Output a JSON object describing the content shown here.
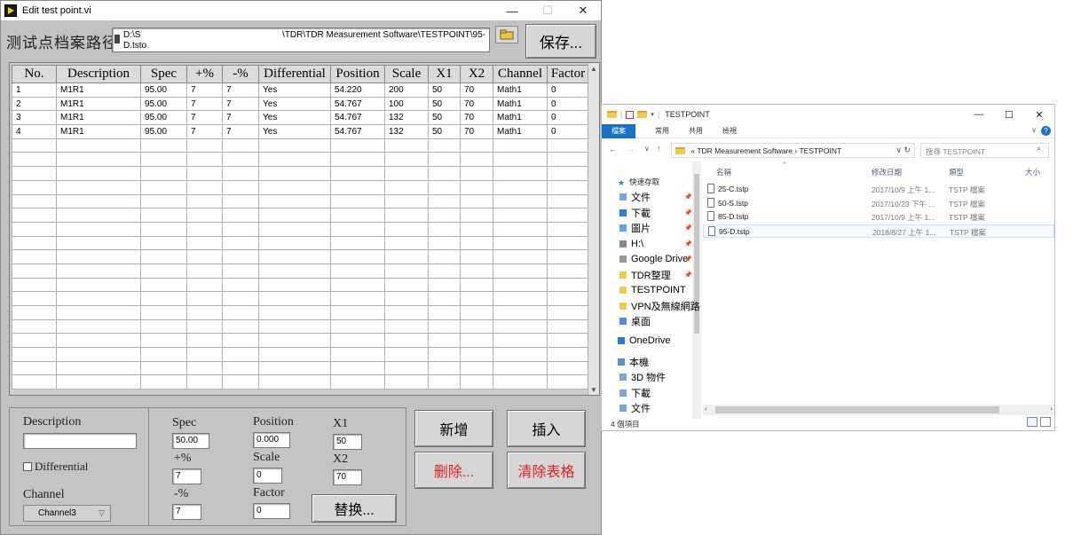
{
  "lv": {
    "title": "Edit test point.vi",
    "path_label": "测试点档案路径",
    "path_line1_left": "D:\\S",
    "path_line1_right": "\\TDR\\TDR Measurement Software\\TESTPOINT\\95-",
    "path_line2": "D.tsto",
    "save_label": "保存...",
    "columns": [
      "No.",
      "Description",
      "Spec",
      "+%",
      "-%",
      "Differential",
      "Position",
      "Scale",
      "X1",
      "X2",
      "Channel",
      "Factor"
    ],
    "rows": [
      [
        "1",
        "M1R1",
        "95.00",
        "7",
        "7",
        "Yes",
        "54.220",
        "200",
        "50",
        "70",
        "Math1",
        "0"
      ],
      [
        "2",
        "M1R1",
        "95.00",
        "7",
        "7",
        "Yes",
        "54.767",
        "100",
        "50",
        "70",
        "Math1",
        "0"
      ],
      [
        "3",
        "M1R1",
        "95.00",
        "7",
        "7",
        "Yes",
        "54.767",
        "132",
        "50",
        "70",
        "Math1",
        "0"
      ],
      [
        "4",
        "M1R1",
        "95.00",
        "7",
        "7",
        "Yes",
        "54.767",
        "132",
        "50",
        "70",
        "Math1",
        "0"
      ]
    ],
    "form": {
      "description_label": "Description",
      "description_value": "",
      "differential_label": "Differential",
      "channel_label": "Channel",
      "channel_value": "Channel3",
      "spec_label": "Spec",
      "spec_value": "50.00",
      "plus_label": "+%",
      "plus_value": "7",
      "minus_label": "-%",
      "minus_value": "7",
      "position_label": "Position",
      "position_value": "0.000",
      "scale_label": "Scale",
      "scale_value": "0",
      "factor_label": "Factor",
      "factor_value": "0",
      "x1_label": "X1",
      "x1_value": "50",
      "x2_label": "X2",
      "x2_value": "70"
    },
    "buttons": {
      "add": "新增",
      "insert": "插入",
      "delete": "删除...",
      "clear": "清除表格",
      "replace": "替换..."
    }
  },
  "explorer": {
    "title": "TESTPOINT",
    "ribbon_tabs": [
      "檔案",
      "常用",
      "共用",
      "檢視"
    ],
    "address": [
      "TDR Measurement Software",
      "TESTPOINT"
    ],
    "search_placeholder": "搜尋 TESTPOINT",
    "sidebar": {
      "quick_access": "快速存取",
      "items": [
        "文件",
        "下載",
        "圖片",
        "H:\\",
        "Google Drive",
        "TDR整理",
        "TESTPOINT",
        "VPN及無線網路",
        "桌面"
      ],
      "onedrive": "OneDrive",
      "this_pc": "本機",
      "pc_items": [
        "3D 物件",
        "下載",
        "文件"
      ]
    },
    "columns": [
      "名稱",
      "修改日期",
      "類型",
      "大小"
    ],
    "files": [
      {
        "name": "25-C.tstp",
        "date": "2017/10/9 上午 1...",
        "type": "TSTP 檔案"
      },
      {
        "name": "50-S.tstp",
        "date": "2017/10/23 下午 ...",
        "type": "TSTP 檔案"
      },
      {
        "name": "85-D.tstp",
        "date": "2017/10/9 上午 1...",
        "type": "TSTP 檔案"
      },
      {
        "name": "95-D.tstp",
        "date": "2018/8/27 上午 1...",
        "type": "TSTP 檔案"
      }
    ],
    "status": "4 個項目"
  }
}
